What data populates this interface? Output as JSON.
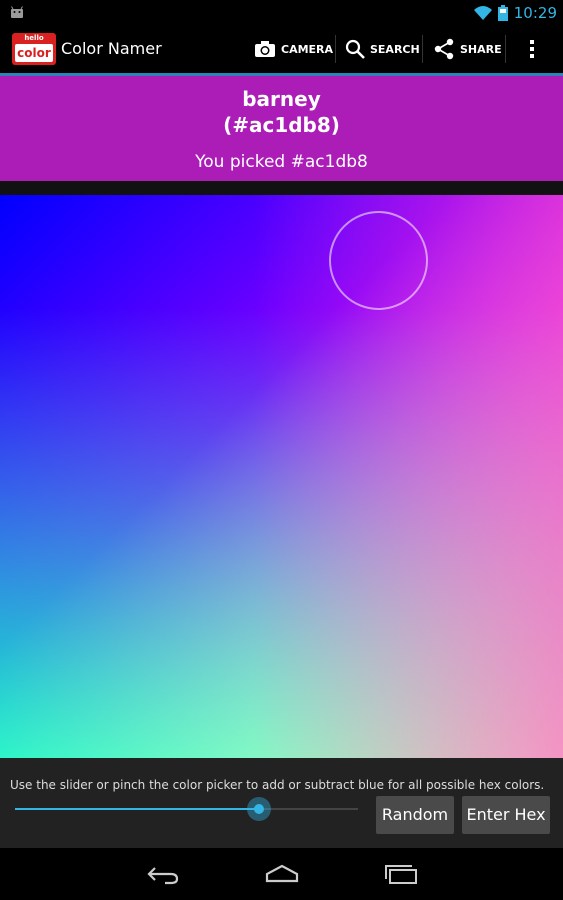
{
  "status_bar": {
    "time": "10:29",
    "icons": [
      "android-icon",
      "wifi-icon",
      "battery-icon"
    ]
  },
  "action_bar": {
    "logo_top": "hello",
    "logo_bottom": "color",
    "title": "Color Namer",
    "actions": [
      {
        "label": "CAMERA",
        "icon": "camera-icon"
      },
      {
        "label": "SEARCH",
        "icon": "search-icon"
      },
      {
        "label": "SHARE",
        "icon": "share-icon"
      }
    ],
    "overflow_icon": "overflow-menu-icon",
    "accent_line_color": "#2a84b8"
  },
  "color_info": {
    "name": "barney",
    "hex_display": "(#ac1db8)",
    "picked_message": "You picked #ac1db8",
    "background_color": "#ac1db8"
  },
  "controls": {
    "hint": "Use the slider or pinch the color picker to add or subtract blue for all possible hex colors.",
    "slider_value_percent": 71,
    "random_label": "Random",
    "enter_hex_label": "Enter Hex"
  },
  "nav_bar": {
    "icons": [
      "back-icon",
      "home-icon",
      "recent-apps-icon"
    ]
  }
}
